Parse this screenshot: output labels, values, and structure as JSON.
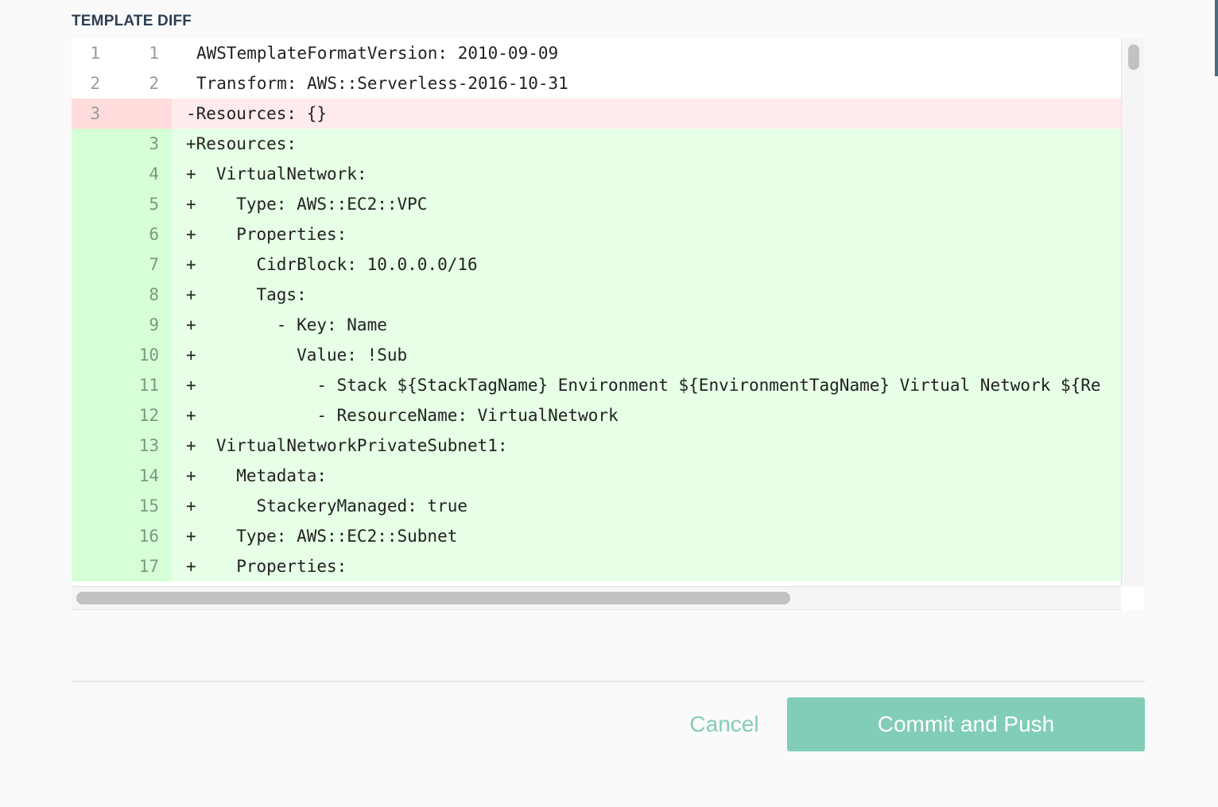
{
  "section": {
    "title": "TEMPLATE DIFF"
  },
  "diff": {
    "rows": [
      {
        "type": "context",
        "old": "1",
        "new": "1",
        "text": "AWSTemplateFormatVersion: 2010-09-09"
      },
      {
        "type": "context",
        "old": "2",
        "new": "2",
        "text": "Transform: AWS::Serverless-2016-10-31"
      },
      {
        "type": "removed",
        "old": "3",
        "new": "",
        "text": "-Resources: {}"
      },
      {
        "type": "added",
        "old": "",
        "new": "3",
        "text": "+Resources:"
      },
      {
        "type": "added",
        "old": "",
        "new": "4",
        "text": "+  VirtualNetwork:"
      },
      {
        "type": "added",
        "old": "",
        "new": "5",
        "text": "+    Type: AWS::EC2::VPC"
      },
      {
        "type": "added",
        "old": "",
        "new": "6",
        "text": "+    Properties:"
      },
      {
        "type": "added",
        "old": "",
        "new": "7",
        "text": "+      CidrBlock: 10.0.0.0/16"
      },
      {
        "type": "added",
        "old": "",
        "new": "8",
        "text": "+      Tags:"
      },
      {
        "type": "added",
        "old": "",
        "new": "9",
        "text": "+        - Key: Name"
      },
      {
        "type": "added",
        "old": "",
        "new": "10",
        "text": "+          Value: !Sub"
      },
      {
        "type": "added",
        "old": "",
        "new": "11",
        "text": "+            - Stack ${StackTagName} Environment ${EnvironmentTagName} Virtual Network ${Re"
      },
      {
        "type": "added",
        "old": "",
        "new": "12",
        "text": "+            - ResourceName: VirtualNetwork"
      },
      {
        "type": "added",
        "old": "",
        "new": "13",
        "text": "+  VirtualNetworkPrivateSubnet1:"
      },
      {
        "type": "added",
        "old": "",
        "new": "14",
        "text": "+    Metadata:"
      },
      {
        "type": "added",
        "old": "",
        "new": "15",
        "text": "+      StackeryManaged: true"
      },
      {
        "type": "added",
        "old": "",
        "new": "16",
        "text": "+    Type: AWS::EC2::Subnet"
      },
      {
        "type": "added",
        "old": "",
        "new": "17",
        "text": "+    Properties:"
      }
    ]
  },
  "footer": {
    "cancel_label": "Cancel",
    "commit_label": "Commit and Push"
  },
  "colors": {
    "accent": "#82cdb7",
    "removed_bg": "#ffebeb",
    "added_bg": "#e6ffe6"
  }
}
